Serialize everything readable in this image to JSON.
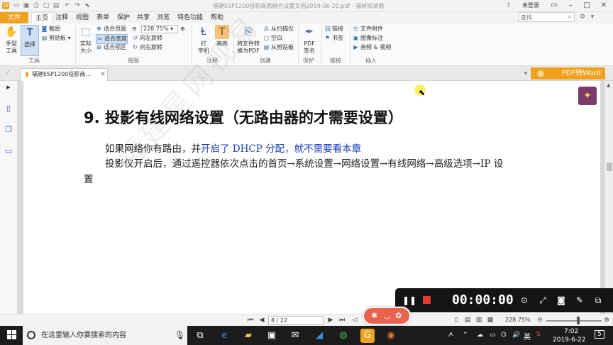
{
  "window": {
    "title": "福建ESP1200投影商面融合设置文档2019-06-20.pdf - 福昕阅读器",
    "login_label": "未登录"
  },
  "menu": {
    "file_label": "文件",
    "items": [
      "主页",
      "注释",
      "视图",
      "表单",
      "保护",
      "共享",
      "浏览",
      "特色功能",
      "帮助"
    ],
    "search_placeholder": "查找"
  },
  "ribbon": {
    "hand_tool": "手型\n工具",
    "select_tool": "选择",
    "screenshot": "截图",
    "clipboard": "剪贴板",
    "group_tools": "工具",
    "actual_size": "实际\n大小",
    "fit_page": "适合页面",
    "fit_width": "适合宽度",
    "fit_visible": "适合视区",
    "zoom_value": "228.75%",
    "rotate_left": "向左旋转",
    "rotate_right": "向右旋转",
    "group_view": "视图",
    "typewriter": "打\n字机",
    "highlight": "高亮",
    "group_comment": "注释",
    "to_pdf": "将文件转\n换为PDF",
    "from_scanner": "从扫描仪",
    "blank": "空白",
    "from_clipboard": "从剪贴板",
    "group_create": "创建",
    "pdf_sign": "PDF\n签名",
    "group_protect": "保护",
    "link": "链接",
    "bookmark": "书签",
    "group_links": "链接",
    "file_attachment": "文件附件",
    "image_annotation": "图像标注",
    "audio_video": "音频 & 视频",
    "group_insert": "插入"
  },
  "tabs": {
    "doc_tab": "福建ESP1200投影商...",
    "pdf_to_word": "PDF转Word"
  },
  "document": {
    "watermark": "福建星网视易",
    "heading": "9. 投影有线网络设置（无路由器的才需要设置）",
    "line1_a": "如果网络你有路由，并",
    "line1_b": "开启了 DHCP 分配，就不需要看本章",
    "line2": "投影仪开启后，通过遥控器依次点击的首页→系统设置→网络设置→有线网络→高级选项→IP 设",
    "line3": "置"
  },
  "status": {
    "page_indicator": "8 / 22",
    "zoom": "228.75%"
  },
  "recorder": {
    "time": "00:00:00"
  },
  "taskbar": {
    "search_placeholder": "在这里输入你要搜索的内容",
    "time": "7:02",
    "date": "2019-6-22",
    "ime": "英",
    "notifications": "5"
  },
  "colors": {
    "accent": "#f0a21e",
    "link_blue": "#1a3ec0",
    "recorder_bg": "#141414",
    "stop_red": "#e53935"
  }
}
